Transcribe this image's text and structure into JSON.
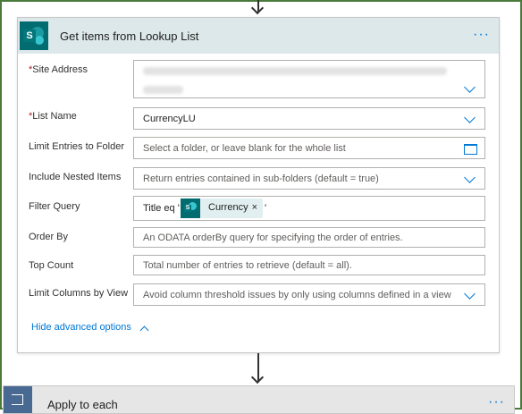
{
  "step": {
    "title": "Get items from Lookup List",
    "menu": "···",
    "fields": {
      "site_address": {
        "label": "Site Address",
        "required_mark": "*"
      },
      "list_name": {
        "label": "List Name",
        "required_mark": "*",
        "value": "CurrencyLU"
      },
      "limit_folder": {
        "label": "Limit Entries to Folder",
        "placeholder": "Select a folder, or leave blank for the whole list"
      },
      "nested": {
        "label": "Include Nested Items",
        "value": "Return entries contained in sub-folders (default = true)"
      },
      "filter": {
        "label": "Filter Query",
        "prefix": "Title eq '",
        "token": "Currency",
        "token_close": "×",
        "suffix": "'"
      },
      "order_by": {
        "label": "Order By",
        "placeholder": "An ODATA orderBy query for specifying the order of entries."
      },
      "top_count": {
        "label": "Top Count",
        "placeholder": "Total number of entries to retrieve (default = all)."
      },
      "limit_columns": {
        "label": "Limit Columns by View",
        "value": "Avoid column threshold issues by only using columns defined in a view"
      }
    },
    "advanced_toggle": "Hide advanced options"
  },
  "next_step": {
    "title": "Apply to each",
    "menu": "···"
  },
  "icons": {
    "sharepoint": "sharepoint-icon",
    "loop": "loop-icon",
    "folder": "folder-icon",
    "chevron": "chevron-down-icon"
  },
  "colors": {
    "accent": "#0078d4",
    "header_bg": "#dce8ea",
    "sharepoint": "#036c70",
    "loop": "#486991"
  }
}
